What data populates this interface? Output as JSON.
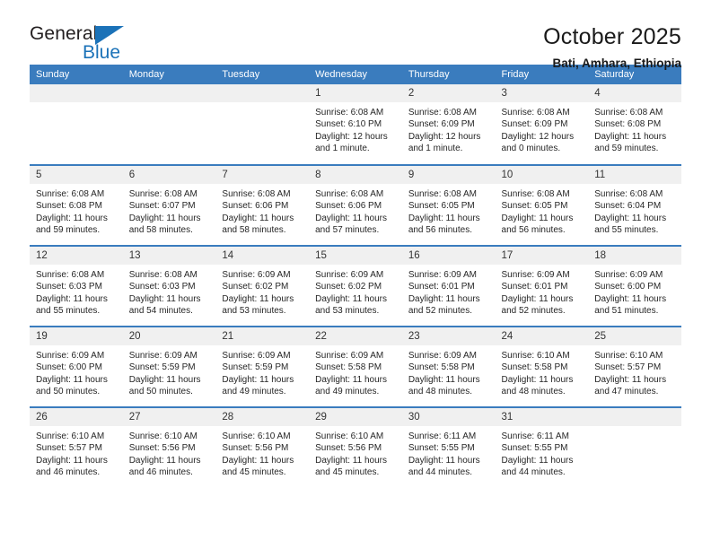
{
  "brand": {
    "name_top": "General",
    "name_bottom": "Blue",
    "accent_color": "#1b72b8"
  },
  "header": {
    "title": "October 2025",
    "subtitle": "Bati, Amhara, Ethiopia"
  },
  "calendar": {
    "header_bg": "#3a7cbe",
    "weekday_headers": [
      "Sunday",
      "Monday",
      "Tuesday",
      "Wednesday",
      "Thursday",
      "Friday",
      "Saturday"
    ],
    "weeks": [
      [
        {
          "day": "",
          "empty": true
        },
        {
          "day": "",
          "empty": true
        },
        {
          "day": "",
          "empty": true
        },
        {
          "day": "1",
          "sunrise": "Sunrise: 6:08 AM",
          "sunset": "Sunset: 6:10 PM",
          "daylight": "Daylight: 12 hours and 1 minute."
        },
        {
          "day": "2",
          "sunrise": "Sunrise: 6:08 AM",
          "sunset": "Sunset: 6:09 PM",
          "daylight": "Daylight: 12 hours and 1 minute."
        },
        {
          "day": "3",
          "sunrise": "Sunrise: 6:08 AM",
          "sunset": "Sunset: 6:09 PM",
          "daylight": "Daylight: 12 hours and 0 minutes."
        },
        {
          "day": "4",
          "sunrise": "Sunrise: 6:08 AM",
          "sunset": "Sunset: 6:08 PM",
          "daylight": "Daylight: 11 hours and 59 minutes."
        }
      ],
      [
        {
          "day": "5",
          "sunrise": "Sunrise: 6:08 AM",
          "sunset": "Sunset: 6:08 PM",
          "daylight": "Daylight: 11 hours and 59 minutes."
        },
        {
          "day": "6",
          "sunrise": "Sunrise: 6:08 AM",
          "sunset": "Sunset: 6:07 PM",
          "daylight": "Daylight: 11 hours and 58 minutes."
        },
        {
          "day": "7",
          "sunrise": "Sunrise: 6:08 AM",
          "sunset": "Sunset: 6:06 PM",
          "daylight": "Daylight: 11 hours and 58 minutes."
        },
        {
          "day": "8",
          "sunrise": "Sunrise: 6:08 AM",
          "sunset": "Sunset: 6:06 PM",
          "daylight": "Daylight: 11 hours and 57 minutes."
        },
        {
          "day": "9",
          "sunrise": "Sunrise: 6:08 AM",
          "sunset": "Sunset: 6:05 PM",
          "daylight": "Daylight: 11 hours and 56 minutes."
        },
        {
          "day": "10",
          "sunrise": "Sunrise: 6:08 AM",
          "sunset": "Sunset: 6:05 PM",
          "daylight": "Daylight: 11 hours and 56 minutes."
        },
        {
          "day": "11",
          "sunrise": "Sunrise: 6:08 AM",
          "sunset": "Sunset: 6:04 PM",
          "daylight": "Daylight: 11 hours and 55 minutes."
        }
      ],
      [
        {
          "day": "12",
          "sunrise": "Sunrise: 6:08 AM",
          "sunset": "Sunset: 6:03 PM",
          "daylight": "Daylight: 11 hours and 55 minutes."
        },
        {
          "day": "13",
          "sunrise": "Sunrise: 6:08 AM",
          "sunset": "Sunset: 6:03 PM",
          "daylight": "Daylight: 11 hours and 54 minutes."
        },
        {
          "day": "14",
          "sunrise": "Sunrise: 6:09 AM",
          "sunset": "Sunset: 6:02 PM",
          "daylight": "Daylight: 11 hours and 53 minutes."
        },
        {
          "day": "15",
          "sunrise": "Sunrise: 6:09 AM",
          "sunset": "Sunset: 6:02 PM",
          "daylight": "Daylight: 11 hours and 53 minutes."
        },
        {
          "day": "16",
          "sunrise": "Sunrise: 6:09 AM",
          "sunset": "Sunset: 6:01 PM",
          "daylight": "Daylight: 11 hours and 52 minutes."
        },
        {
          "day": "17",
          "sunrise": "Sunrise: 6:09 AM",
          "sunset": "Sunset: 6:01 PM",
          "daylight": "Daylight: 11 hours and 52 minutes."
        },
        {
          "day": "18",
          "sunrise": "Sunrise: 6:09 AM",
          "sunset": "Sunset: 6:00 PM",
          "daylight": "Daylight: 11 hours and 51 minutes."
        }
      ],
      [
        {
          "day": "19",
          "sunrise": "Sunrise: 6:09 AM",
          "sunset": "Sunset: 6:00 PM",
          "daylight": "Daylight: 11 hours and 50 minutes."
        },
        {
          "day": "20",
          "sunrise": "Sunrise: 6:09 AM",
          "sunset": "Sunset: 5:59 PM",
          "daylight": "Daylight: 11 hours and 50 minutes."
        },
        {
          "day": "21",
          "sunrise": "Sunrise: 6:09 AM",
          "sunset": "Sunset: 5:59 PM",
          "daylight": "Daylight: 11 hours and 49 minutes."
        },
        {
          "day": "22",
          "sunrise": "Sunrise: 6:09 AM",
          "sunset": "Sunset: 5:58 PM",
          "daylight": "Daylight: 11 hours and 49 minutes."
        },
        {
          "day": "23",
          "sunrise": "Sunrise: 6:09 AM",
          "sunset": "Sunset: 5:58 PM",
          "daylight": "Daylight: 11 hours and 48 minutes."
        },
        {
          "day": "24",
          "sunrise": "Sunrise: 6:10 AM",
          "sunset": "Sunset: 5:58 PM",
          "daylight": "Daylight: 11 hours and 48 minutes."
        },
        {
          "day": "25",
          "sunrise": "Sunrise: 6:10 AM",
          "sunset": "Sunset: 5:57 PM",
          "daylight": "Daylight: 11 hours and 47 minutes."
        }
      ],
      [
        {
          "day": "26",
          "sunrise": "Sunrise: 6:10 AM",
          "sunset": "Sunset: 5:57 PM",
          "daylight": "Daylight: 11 hours and 46 minutes."
        },
        {
          "day": "27",
          "sunrise": "Sunrise: 6:10 AM",
          "sunset": "Sunset: 5:56 PM",
          "daylight": "Daylight: 11 hours and 46 minutes."
        },
        {
          "day": "28",
          "sunrise": "Sunrise: 6:10 AM",
          "sunset": "Sunset: 5:56 PM",
          "daylight": "Daylight: 11 hours and 45 minutes."
        },
        {
          "day": "29",
          "sunrise": "Sunrise: 6:10 AM",
          "sunset": "Sunset: 5:56 PM",
          "daylight": "Daylight: 11 hours and 45 minutes."
        },
        {
          "day": "30",
          "sunrise": "Sunrise: 6:11 AM",
          "sunset": "Sunset: 5:55 PM",
          "daylight": "Daylight: 11 hours and 44 minutes."
        },
        {
          "day": "31",
          "sunrise": "Sunrise: 6:11 AM",
          "sunset": "Sunset: 5:55 PM",
          "daylight": "Daylight: 11 hours and 44 minutes."
        },
        {
          "day": "",
          "empty": true
        }
      ]
    ]
  }
}
